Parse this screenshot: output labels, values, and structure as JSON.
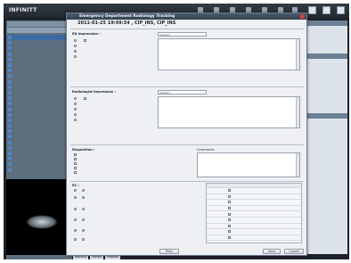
{
  "app": {
    "logo": "INFINITT"
  },
  "dialog": {
    "title": "Emergency Department Radiology Tracking",
    "subtitle": "2011-01-25 19:49:34 , CIP_INS, CIP_INS"
  },
  "sections": {
    "preliminary": {
      "label": "ED Impression :",
      "select_placeholder": "[Select]"
    },
    "radiologist": {
      "label": "Radiologist Impression :",
      "select_placeholder": "[Select]"
    },
    "disposition": {
      "label": "Disposition :",
      "comments_label": "Comments"
    },
    "rc": {
      "label": "RC :"
    }
  },
  "buttons": {
    "print": "Print",
    "save": "Save",
    "cancel": "Cancel"
  },
  "status_tabs": [
    "Worklist",
    "Viewer",
    "Reports"
  ]
}
